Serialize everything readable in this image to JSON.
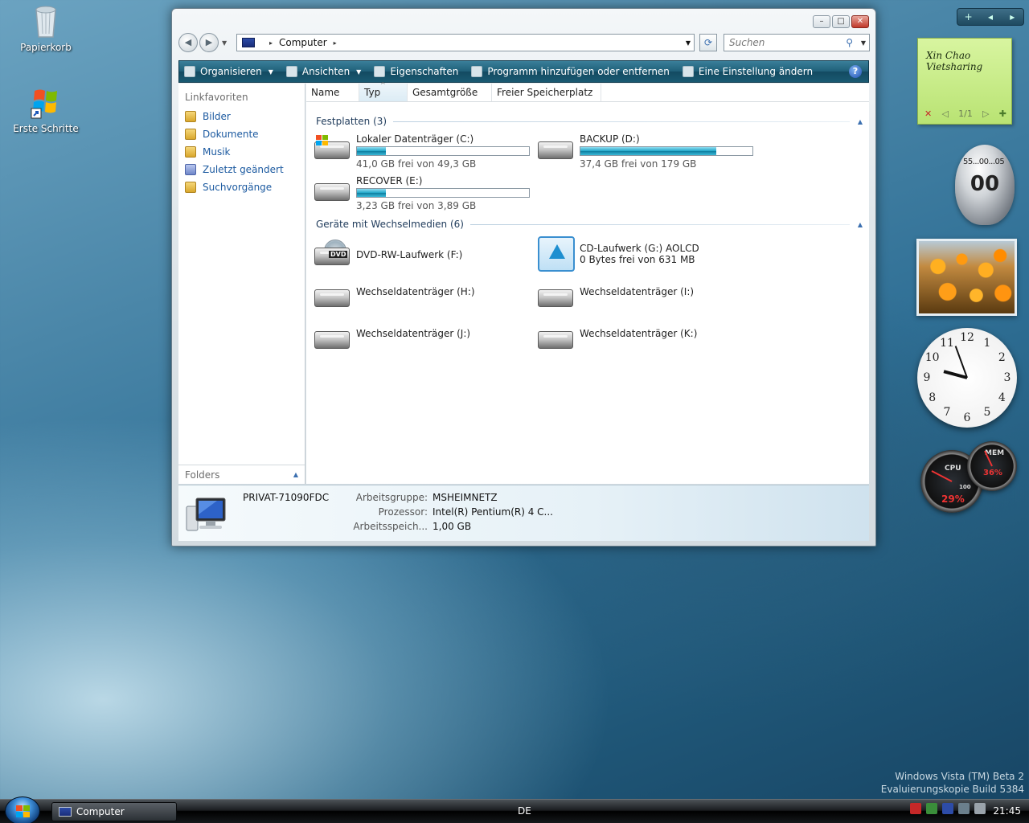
{
  "desktop": {
    "icons": [
      {
        "label": "Papierkorb"
      },
      {
        "label": "Erste Schritte"
      }
    ]
  },
  "window": {
    "controls": {
      "minimize": "–",
      "maximize": "□",
      "close": "✕"
    },
    "address": {
      "root_glyph": "▸",
      "location": "Computer",
      "after_glyph": "▸",
      "dropdown": "▼"
    },
    "search_placeholder": "Suchen",
    "toolbar": {
      "organize": "Organisieren",
      "views": "Ansichten",
      "properties": "Eigenschaften",
      "add_remove": "Programm hinzufügen oder entfernen",
      "change_setting": "Eine Einstellung ändern",
      "help": "?"
    },
    "left_pane": {
      "title": "Linkfavoriten",
      "items": [
        "Bilder",
        "Dokumente",
        "Musik",
        "Zuletzt geändert",
        "Suchvorgänge"
      ],
      "folders_label": "Folders"
    },
    "columns": [
      "Name",
      "Typ",
      "Gesamtgröße",
      "Freier Speicherplatz"
    ],
    "groups": {
      "hard_disks": {
        "title": "Festplatten (3)",
        "drives": [
          {
            "name": "Lokaler Datenträger (C:)",
            "sub": "41,0 GB frei von 49,3 GB",
            "used_fraction": 0.17
          },
          {
            "name": "BACKUP (D:)",
            "sub": "37,4 GB frei von 179 GB",
            "used_fraction": 0.79
          },
          {
            "name": "RECOVER (E:)",
            "sub": "3,23 GB frei von 3,89 GB",
            "used_fraction": 0.17
          }
        ]
      },
      "removable": {
        "title": "Geräte mit Wechselmedien (6)",
        "drives": [
          {
            "name": "DVD-RW-Laufwerk (F:)",
            "icon_text": "DVD"
          },
          {
            "name": "CD-Laufwerk (G:) AOLCD",
            "sub": "0 Bytes frei von 631 MB"
          },
          {
            "name": "Wechseldatenträger (H:)"
          },
          {
            "name": "Wechseldatenträger (I:)"
          },
          {
            "name": "Wechseldatenträger (J:)"
          },
          {
            "name": "Wechseldatenträger (K:)"
          }
        ]
      }
    },
    "details": {
      "computer_name": "PRIVAT-71090FDC",
      "workgroup_label": "Arbeitsgruppe:",
      "workgroup": "MSHEIMNETZ",
      "processor_label": "Prozessor:",
      "processor": "Intel(R) Pentium(R) 4 C...",
      "memory_label": "Arbeitsspeich...",
      "memory": "1,00 GB"
    }
  },
  "sidebar": {
    "controls": {
      "add": "+",
      "prev": "◂",
      "next": "▸"
    },
    "note": {
      "line1": "Xin Chao",
      "line2": "Vietsharing",
      "pager": "1/1",
      "delete": "✕",
      "prev": "◁",
      "next": "▷",
      "add": "✚"
    },
    "timer": {
      "scale": "55...00...05",
      "value": "00"
    },
    "clock_numbers": [
      "12",
      "1",
      "2",
      "3",
      "4",
      "5",
      "6",
      "7",
      "8",
      "9",
      "10",
      "11"
    ],
    "meter": {
      "cpu_label": "CPU",
      "cpu_pct": "29%",
      "mem_label": "MEM",
      "mem_pct": "36%",
      "scale": "100"
    }
  },
  "watermark": {
    "line1": "Windows Vista (TM) Beta 2",
    "line2": "Evaluierungskopie Build 5384"
  },
  "taskbar": {
    "task": "Computer",
    "language": "DE",
    "time": "21:45"
  },
  "colors": {
    "toolbar": "#1f5f78",
    "link": "#1c5aa0",
    "bar_fill": "#1fa6c8"
  }
}
